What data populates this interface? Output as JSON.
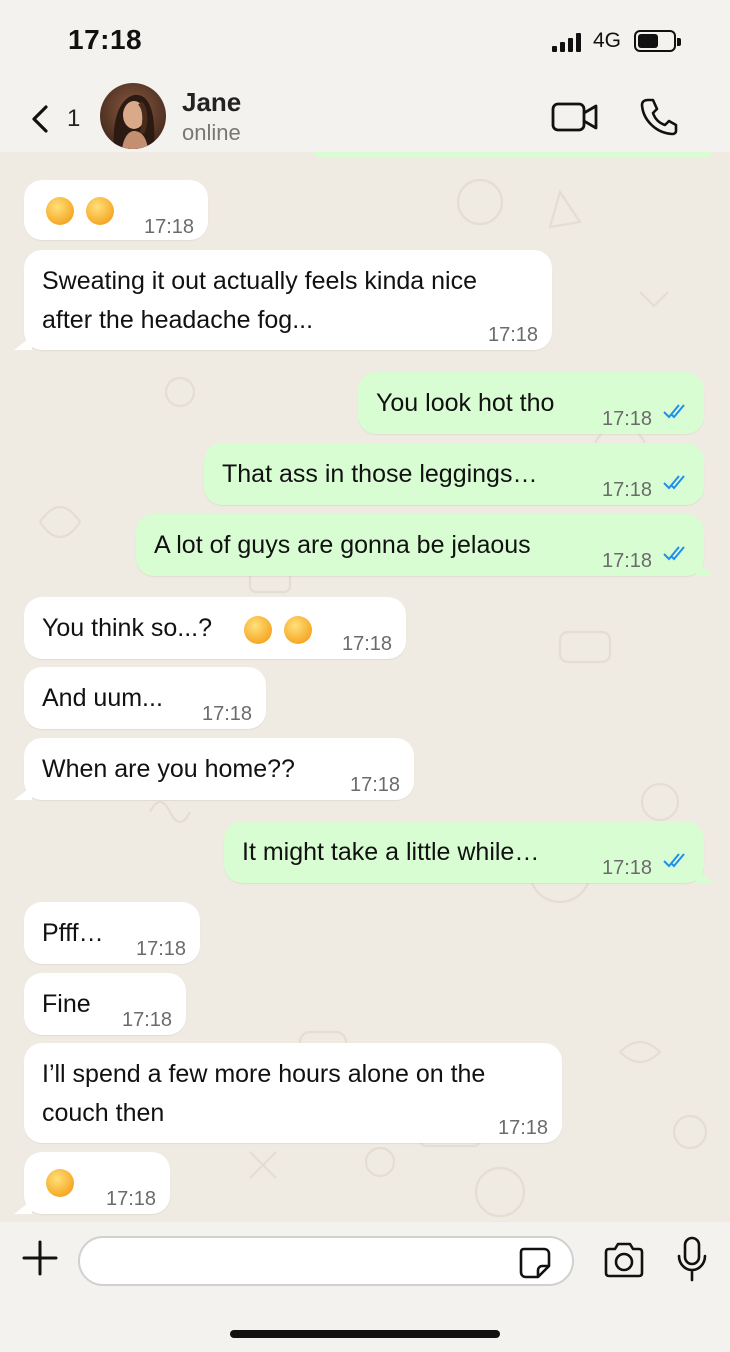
{
  "status_bar": {
    "time": "17:18",
    "network": "4G"
  },
  "header": {
    "back_count": "1",
    "contact_name": "Jane",
    "contact_status": "online",
    "icons": [
      "back-chevron-icon",
      "video-camera-icon",
      "phone-icon"
    ]
  },
  "colors": {
    "incoming_bubble": "#ffffff",
    "outgoing_bubble": "#d9fdd3",
    "chat_background": "#efeae2",
    "read_ticks": "#1f8ef1"
  },
  "messages": [
    {
      "direction": "incoming",
      "text": "",
      "emoji": [
        "flushed-face",
        "flushed-face"
      ],
      "time": "17:18"
    },
    {
      "direction": "incoming",
      "text_line1": "Sweating it out actually feels kinda nice",
      "text_line2": "after the headache fog...",
      "time": "17:18"
    },
    {
      "direction": "outgoing",
      "text": "You look hot tho",
      "time": "17:18",
      "status": "read"
    },
    {
      "direction": "outgoing",
      "text": "That ass in those leggings…",
      "time": "17:18",
      "status": "read"
    },
    {
      "direction": "outgoing",
      "text": "A lot of guys are gonna be jelaous",
      "time": "17:18",
      "status": "read"
    },
    {
      "direction": "incoming",
      "text": "You think so...?",
      "emoji": [
        "upside-down-face",
        "upside-down-face"
      ],
      "time": "17:18"
    },
    {
      "direction": "incoming",
      "text": "And uum...",
      "time": "17:18"
    },
    {
      "direction": "incoming",
      "text": "When are you home??",
      "time": "17:18"
    },
    {
      "direction": "outgoing",
      "text": "It might take a little while…",
      "time": "17:18",
      "status": "read"
    },
    {
      "direction": "incoming",
      "text": "Pfff…",
      "time": "17:18"
    },
    {
      "direction": "incoming",
      "text": "Fine",
      "time": "17:18"
    },
    {
      "direction": "incoming",
      "text_line1": "I’ll spend a few more hours alone on the",
      "text_line2": "couch then",
      "time": "17:18"
    },
    {
      "direction": "incoming",
      "text": "",
      "emoji": [
        "weary-face"
      ],
      "time": "17:18"
    }
  ],
  "input_bar": {
    "placeholder": "",
    "icons": [
      "plus-icon",
      "sticker-icon",
      "camera-icon",
      "microphone-icon"
    ]
  }
}
